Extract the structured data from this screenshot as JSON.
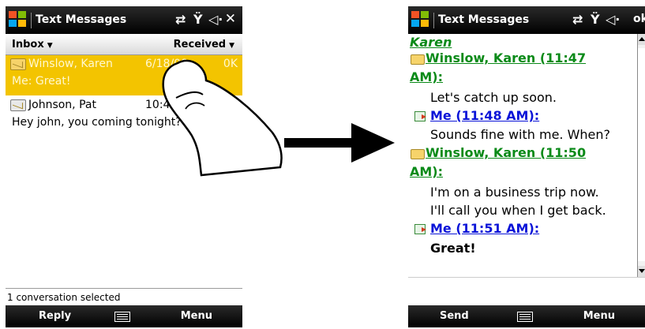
{
  "left_phone": {
    "title": "Text Messages",
    "close_label": "✕",
    "folder_label": "Inbox",
    "sort_label": "Received",
    "messages": [
      {
        "name": "Winslow, Karen",
        "date": "6/18/08",
        "size": "0K",
        "preview": "Me: Great!",
        "selected": true
      },
      {
        "name": "Johnson, Pat",
        "date": "10:45",
        "size": "K",
        "preview": "Hey john, you coming tonight?",
        "selected": false
      }
    ],
    "status": "1 conversation selected",
    "softkey_left": "Reply",
    "softkey_right": "Menu"
  },
  "right_phone": {
    "title": "Text Messages",
    "ok_label": "ok",
    "contact": "Karen",
    "conversation": [
      {
        "sender_line1": "Winslow, Karen (11:47",
        "sender_line2": "AM):",
        "text": [
          "Let's catch up soon."
        ],
        "direction": "in"
      },
      {
        "sender_line1": "Me (11:48 AM):",
        "text": [
          "Sounds fine with me. When?"
        ],
        "direction": "out"
      },
      {
        "sender_line1": "Winslow, Karen (11:50",
        "sender_line2": "AM):",
        "text": [
          "I'm on a business trip now.",
          "I'll call you when I get back."
        ],
        "direction": "in"
      },
      {
        "sender_line1": "Me (11:51 AM):",
        "text": [
          "Great!"
        ],
        "direction": "out"
      }
    ],
    "softkey_left": "Send",
    "softkey_right": "Menu"
  },
  "colors": {
    "selection": "#f3c400",
    "incoming_sender": "#0a8a18",
    "outgoing_sender": "#0a14d8",
    "titlebar": "#000000"
  },
  "icons": [
    "windows-logo-icon",
    "sync-icon",
    "signal-icon",
    "speaker-icon",
    "envelope-icon",
    "keyboard-icon",
    "finger-gesture-icon",
    "arrow-right-icon"
  ]
}
